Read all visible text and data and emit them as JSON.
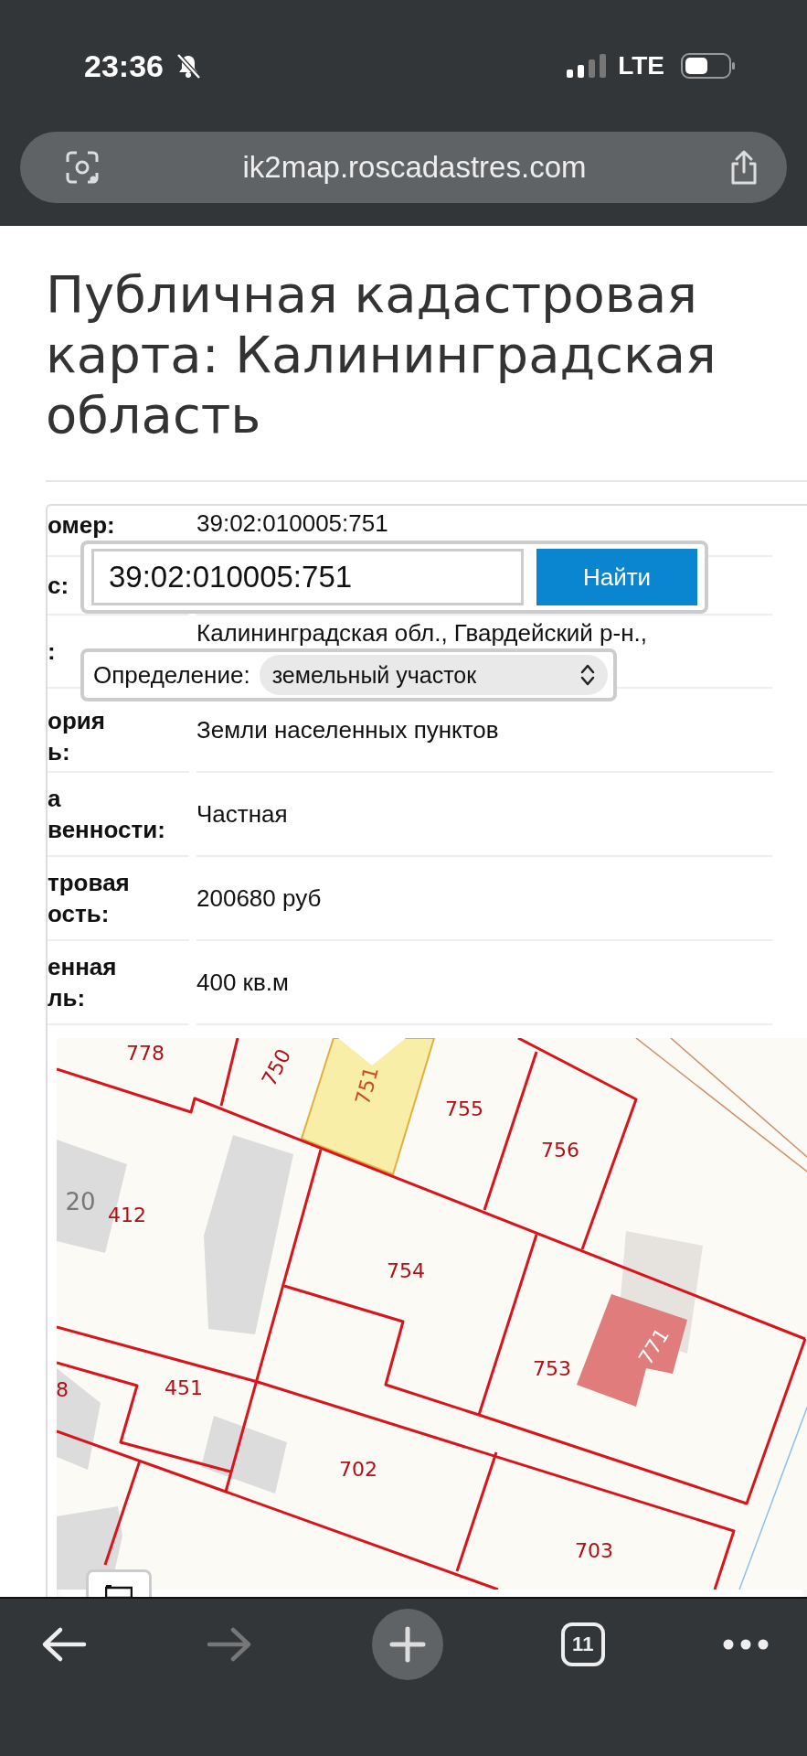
{
  "status_bar": {
    "time": "23:36",
    "network": "LTE"
  },
  "address_bar": {
    "url": "ik2map.roscadastres.com"
  },
  "page": {
    "title": "Публичная кадастровая карта: Калининградская область"
  },
  "info_table": {
    "rows": [
      {
        "label": [
          "омер:"
        ],
        "value": "39:02:010005:751"
      },
      {
        "label": [
          "с:"
        ]
      },
      {
        "label": [
          ":"
        ],
        "value": "Калининградская обл., Гвардейский р-н.,"
      },
      {
        "label": [
          "ория",
          "ь:"
        ],
        "value": "Земли населенных пунктов"
      },
      {
        "label": [
          "а",
          "венности:"
        ],
        "value": "Частная"
      },
      {
        "label": [
          "тровая",
          "ость:"
        ],
        "value": "200680 руб"
      },
      {
        "label": [
          "енная",
          "ль:"
        ],
        "value": "400 кв.м"
      }
    ]
  },
  "search": {
    "value": "39:02:010005:751",
    "button": "Найти"
  },
  "definition": {
    "label": "Определение:",
    "value": "земельный участок"
  },
  "map": {
    "labels": [
      {
        "text": "778",
        "kind": "parcel"
      },
      {
        "text": "750",
        "kind": "parcel"
      },
      {
        "text": "751",
        "kind": "selected"
      },
      {
        "text": "755",
        "kind": "parcel"
      },
      {
        "text": "756",
        "kind": "parcel"
      },
      {
        "text": "20",
        "kind": "house"
      },
      {
        "text": "412",
        "kind": "parcel"
      },
      {
        "text": "754",
        "kind": "parcel"
      },
      {
        "text": "753",
        "kind": "parcel"
      },
      {
        "text": "771",
        "kind": "building"
      },
      {
        "text": "8",
        "kind": "parcel"
      },
      {
        "text": "451",
        "kind": "parcel"
      },
      {
        "text": "702",
        "kind": "parcel"
      },
      {
        "text": "703",
        "kind": "parcel"
      }
    ]
  },
  "toolbar": {
    "forward_disabled": true,
    "tab_count": "11"
  }
}
